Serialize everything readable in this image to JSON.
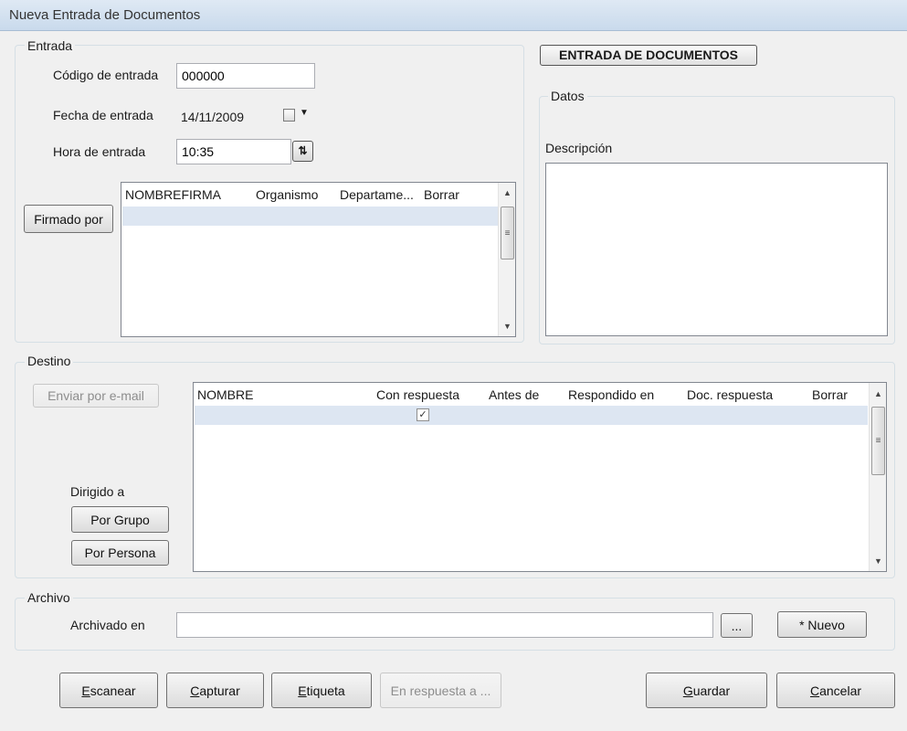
{
  "window": {
    "title": "Nueva Entrada de Documentos"
  },
  "entrada": {
    "legend": "Entrada",
    "codigo_label": "Código de entrada",
    "codigo_value": "000000",
    "fecha_label": "Fecha de entrada",
    "fecha_value": "14/11/2009",
    "hora_label": "Hora de entrada",
    "hora_value": "10:35",
    "firmado_button": "Firmado por",
    "firmas_table": {
      "columns": [
        "NOMBREFIRMA",
        "Organismo",
        "Departame...",
        "Borrar"
      ],
      "rows": [
        {}
      ]
    }
  },
  "header_badge": "ENTRADA DE DOCUMENTOS",
  "datos": {
    "legend": "Datos",
    "descripcion_label": "Descripción",
    "descripcion_value": ""
  },
  "destino": {
    "legend": "Destino",
    "email_button": "Enviar por e-mail",
    "dirigido_label": "Dirigido a",
    "por_grupo_button": "Por Grupo",
    "por_persona_button": "Por Persona",
    "table": {
      "columns": [
        "NOMBRE",
        "Con respuesta",
        "Antes de",
        "Respondido en",
        "Doc. respuesta",
        "Borrar"
      ],
      "rows": [
        {
          "con_respuesta": true
        }
      ]
    }
  },
  "archivo": {
    "legend": "Archivo",
    "archivado_label": "Archivado en",
    "archivado_value": "",
    "browse_button": "...",
    "nuevo_button": "* Nuevo"
  },
  "footer": {
    "escanear": {
      "first": "E",
      "rest": "scanear"
    },
    "capturar": {
      "first": "C",
      "rest": "apturar"
    },
    "etiqueta": {
      "first": "E",
      "rest": "tiqueta"
    },
    "en_respuesta": "En respuesta a ...",
    "guardar": {
      "first": "G",
      "rest": "uardar"
    },
    "cancelar": {
      "first": "C",
      "rest": "ancelar"
    }
  }
}
